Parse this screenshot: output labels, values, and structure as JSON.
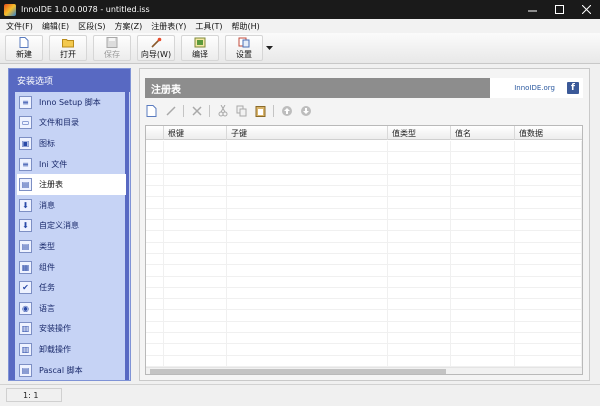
{
  "window": {
    "title": "InnoIDE 1.0.0.0078 - untitled.iss"
  },
  "menu": [
    "文件(F)",
    "编辑(E)",
    "区段(S)",
    "方案(Z)",
    "注册表(Y)",
    "工具(T)",
    "帮助(H)"
  ],
  "toolbar": {
    "new_label": "新建",
    "open_label": "打开",
    "save_label": "保存",
    "wizard_label": "向导(W)",
    "compile_label": "编译",
    "settings_label": "设置"
  },
  "sidebar": {
    "header": "安装选项",
    "items": [
      {
        "label": "Inno Setup 脚本",
        "icon": "script-icon"
      },
      {
        "label": "文件和目录",
        "icon": "folder-icon"
      },
      {
        "label": "图标",
        "icon": "image-icon"
      },
      {
        "label": "Ini 文件",
        "icon": "ini-file-icon"
      },
      {
        "label": "注册表",
        "icon": "registry-icon"
      },
      {
        "label": "消息",
        "icon": "message-icon"
      },
      {
        "label": "自定义消息",
        "icon": "custom-message-icon"
      },
      {
        "label": "类型",
        "icon": "type-icon"
      },
      {
        "label": "组件",
        "icon": "component-icon"
      },
      {
        "label": "任务",
        "icon": "task-icon"
      },
      {
        "label": "语言",
        "icon": "globe-icon"
      },
      {
        "label": "安装操作",
        "icon": "install-run-icon"
      },
      {
        "label": "卸载操作",
        "icon": "uninstall-run-icon"
      },
      {
        "label": "Pascal 脚本",
        "icon": "pascal-script-icon"
      }
    ],
    "active_index": 4
  },
  "main": {
    "title": "注册表",
    "link": "InnoIDE.org",
    "columns": [
      "根键",
      "子键",
      "值类型",
      "值名",
      "值数据"
    ]
  },
  "status": {
    "position": "1:  1"
  },
  "colors": {
    "sidebar_header": "#5869c2",
    "sidebar_bg": "#c6d3f5",
    "panel_header": "#8d8d8d"
  }
}
